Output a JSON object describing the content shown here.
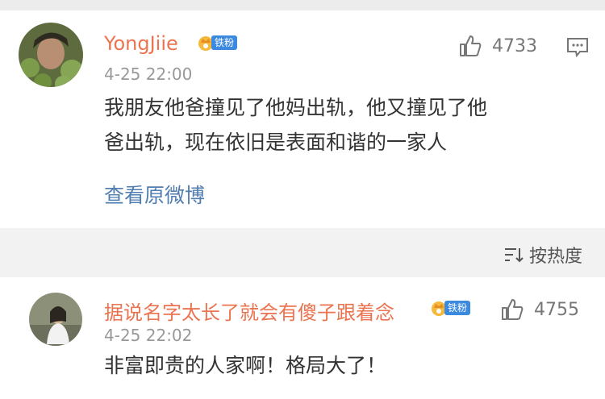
{
  "comments": [
    {
      "username": "YongJiie",
      "badge": "铁粉",
      "time": "4-25 22:00",
      "likes": "4733",
      "content_line1": "我朋友他爸撞见了他妈出轨，他又撞见了他",
      "content_line2": "爸出轨，现在依旧是表面和谐的一家人",
      "link": "查看原微博"
    },
    {
      "username": "据说名字太长了就会有傻子跟着念",
      "badge": "铁粉",
      "time": "4-25 22:02",
      "likes": "4755",
      "content": "非富即贵的人家啊！格局大了！"
    }
  ],
  "sort": {
    "label": "按热度"
  },
  "colors": {
    "username": "#eb7350",
    "link": "#507daf",
    "badge": "#3b8ae0"
  },
  "icons": [
    "thumbs-up-icon",
    "reply-icon",
    "sort-icon",
    "crown-icon"
  ]
}
